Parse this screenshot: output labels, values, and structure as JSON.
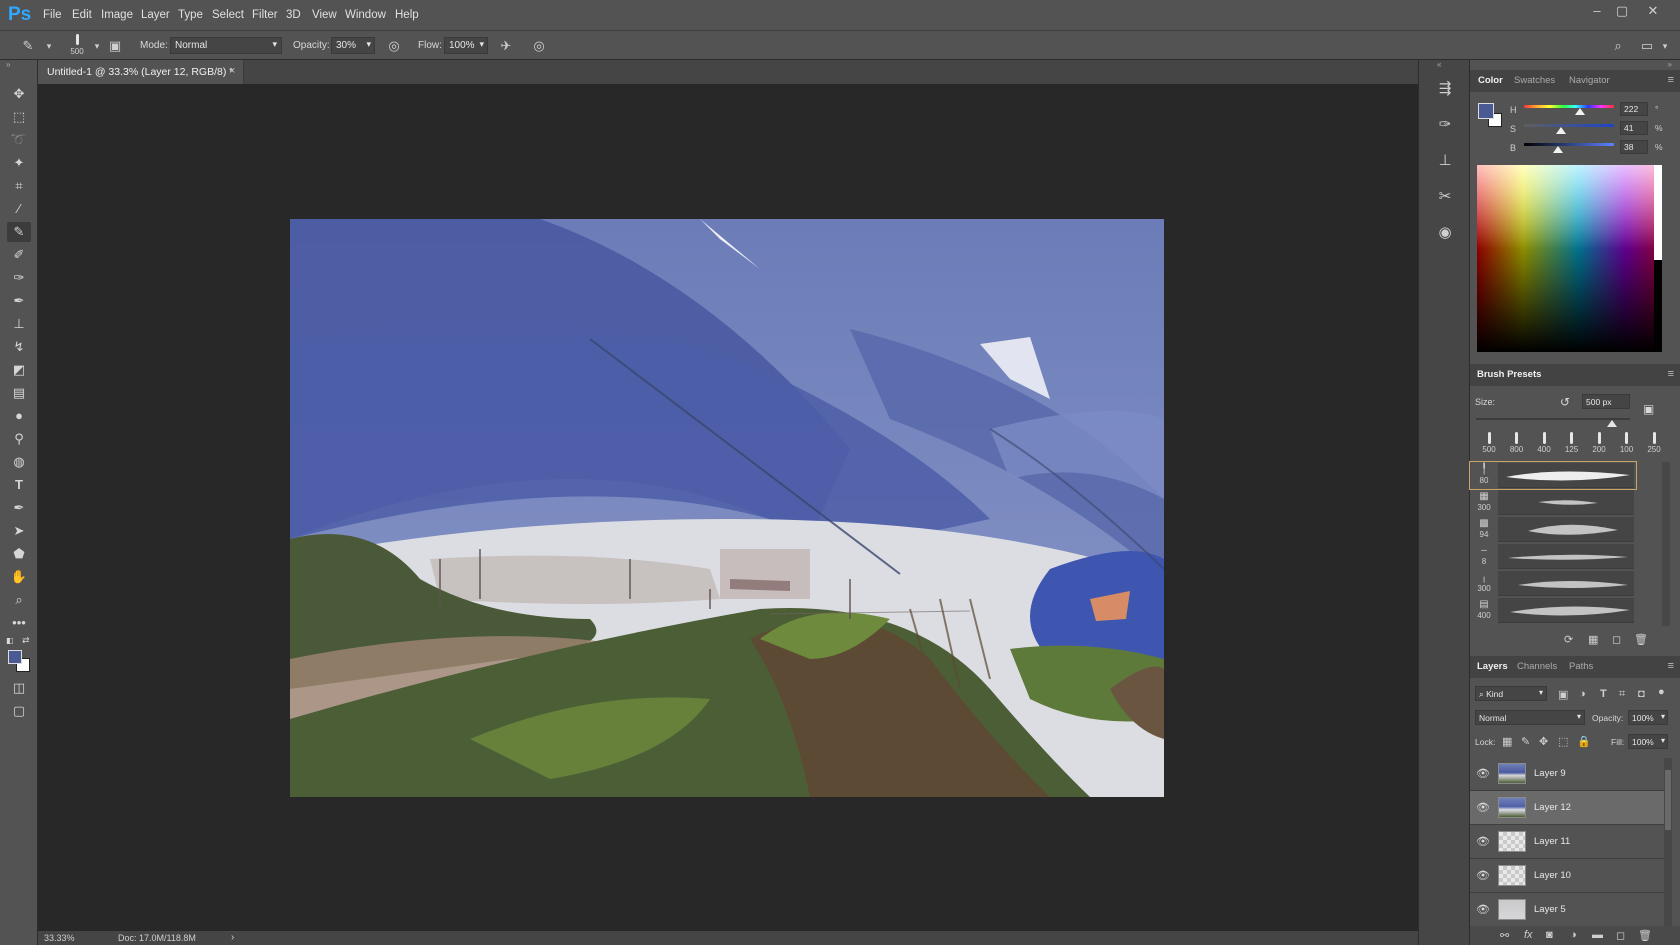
{
  "app": {
    "logo": "Ps",
    "menu": [
      "File",
      "Edit",
      "Image",
      "Layer",
      "Type",
      "Select",
      "Filter",
      "3D",
      "View",
      "Window",
      "Help"
    ],
    "window_controls": [
      "–",
      "▢",
      "✕"
    ]
  },
  "options_bar": {
    "brush_size": "500",
    "mode_label": "Mode:",
    "mode_value": "Normal",
    "opacity_label": "Opacity:",
    "opacity_value": "30%",
    "flow_label": "Flow:",
    "flow_value": "100%"
  },
  "document": {
    "tab_title": "Untitled-1 @ 33.3% (Layer 12, RGB/8) *",
    "close_glyph": "×"
  },
  "status": {
    "zoom": "33.33%",
    "doc_info": "Doc: 17.0M/118.8M",
    "arrow": "›"
  },
  "color_panel": {
    "tabs": [
      "Color",
      "Swatches",
      "Navigator"
    ],
    "active_tab": "Color",
    "foreground_color": "#4a5a92",
    "background_color": "#ffffff",
    "h_label": "H",
    "h_value": "222",
    "h_unit": "°",
    "h_level": 0.62,
    "s_label": "S",
    "s_value": "41",
    "s_unit": "%",
    "s_level": 0.41,
    "b_label": "B",
    "b_value": "38",
    "b_unit": "%",
    "b_level": 0.38
  },
  "brush_presets": {
    "title": "Brush Presets",
    "size_label": "Size:",
    "size_value": "500 px",
    "size_level": 0.88,
    "tips": [
      "500",
      "800",
      "400",
      "125",
      "200",
      "100",
      "250"
    ],
    "presets": [
      {
        "glyph": "╿",
        "size": "80"
      },
      {
        "glyph": "▦",
        "size": "300"
      },
      {
        "glyph": "▩",
        "size": "94"
      },
      {
        "glyph": "–",
        "size": "8"
      },
      {
        "glyph": "╷",
        "size": "300"
      },
      {
        "glyph": "▤",
        "size": "400"
      }
    ]
  },
  "layers_panel": {
    "tabs": [
      "Layers",
      "Channels",
      "Paths"
    ],
    "active_tab": "Layers",
    "filter_label": "Kind",
    "blend_mode": "Normal",
    "opacity_label": "Opacity:",
    "opacity_value": "100%",
    "lock_label": "Lock:",
    "fill_label": "Fill:",
    "fill_value": "100%",
    "layers": [
      {
        "name": "Layer 9",
        "selected": false
      },
      {
        "name": "Layer 12",
        "selected": true
      },
      {
        "name": "Layer 11",
        "selected": false
      },
      {
        "name": "Layer 10",
        "selected": false
      },
      {
        "name": "Layer 5",
        "selected": false
      }
    ]
  },
  "icons": {
    "eye": "eye-icon",
    "lock": "lock-icon",
    "search": "search-icon",
    "link": "link-icon",
    "fx": "fx-icon",
    "mask": "mask-icon",
    "adjustment": "adjustment-icon",
    "group": "folder-icon",
    "new_layer": "new-layer-icon",
    "trash": "trash-icon"
  }
}
